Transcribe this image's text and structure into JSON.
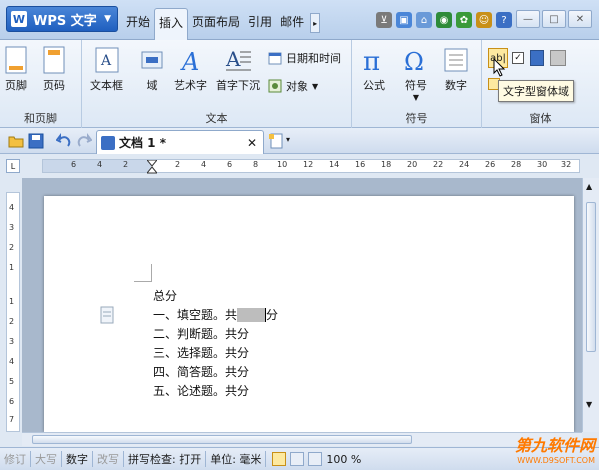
{
  "app": {
    "logo": "W",
    "name": "WPS 文字"
  },
  "tabs": [
    "开始",
    "插入",
    "页面布局",
    "引用",
    "邮件"
  ],
  "active_tab": "插入",
  "ribbon": {
    "groups": [
      {
        "label": "和页脚",
        "buttons": [
          "页脚",
          "页码"
        ]
      },
      {
        "label": "文本",
        "buttons": [
          "文本框",
          "域",
          "艺术字",
          "首字下沉"
        ],
        "small": [
          "日期和时间",
          "对象"
        ]
      },
      {
        "label": "符号",
        "buttons": [
          "公式",
          "符号",
          "数字"
        ]
      },
      {
        "label": "窗体",
        "buttons": []
      }
    ]
  },
  "tooltip": "文字型窗体域",
  "document": {
    "tab_title": "文档 1 *",
    "lines": [
      "总分",
      "一、填空题。共",
      "分",
      "二、判断题。共分",
      "三、选择题。共分",
      "四、简答题。共分",
      "五、论述题。共分"
    ]
  },
  "ruler": {
    "h": [
      "6",
      "4",
      "2",
      "2",
      "4",
      "6",
      "8",
      "10",
      "12",
      "14",
      "16",
      "18",
      "20",
      "22",
      "24",
      "26",
      "28",
      "30",
      "32"
    ],
    "corner": "L"
  },
  "vruler": [
    "4",
    "3",
    "2",
    "1",
    "1",
    "2",
    "3",
    "4",
    "5",
    "6",
    "7",
    "8"
  ],
  "status": {
    "items": [
      "修订",
      "大写",
      "数字",
      "改写",
      "拼写检查: 打开",
      "单位: 毫米"
    ],
    "zoom": "100 %"
  },
  "watermark": {
    "line1": "第九软件网",
    "line2": "WWW.D9SOFT.COM"
  }
}
